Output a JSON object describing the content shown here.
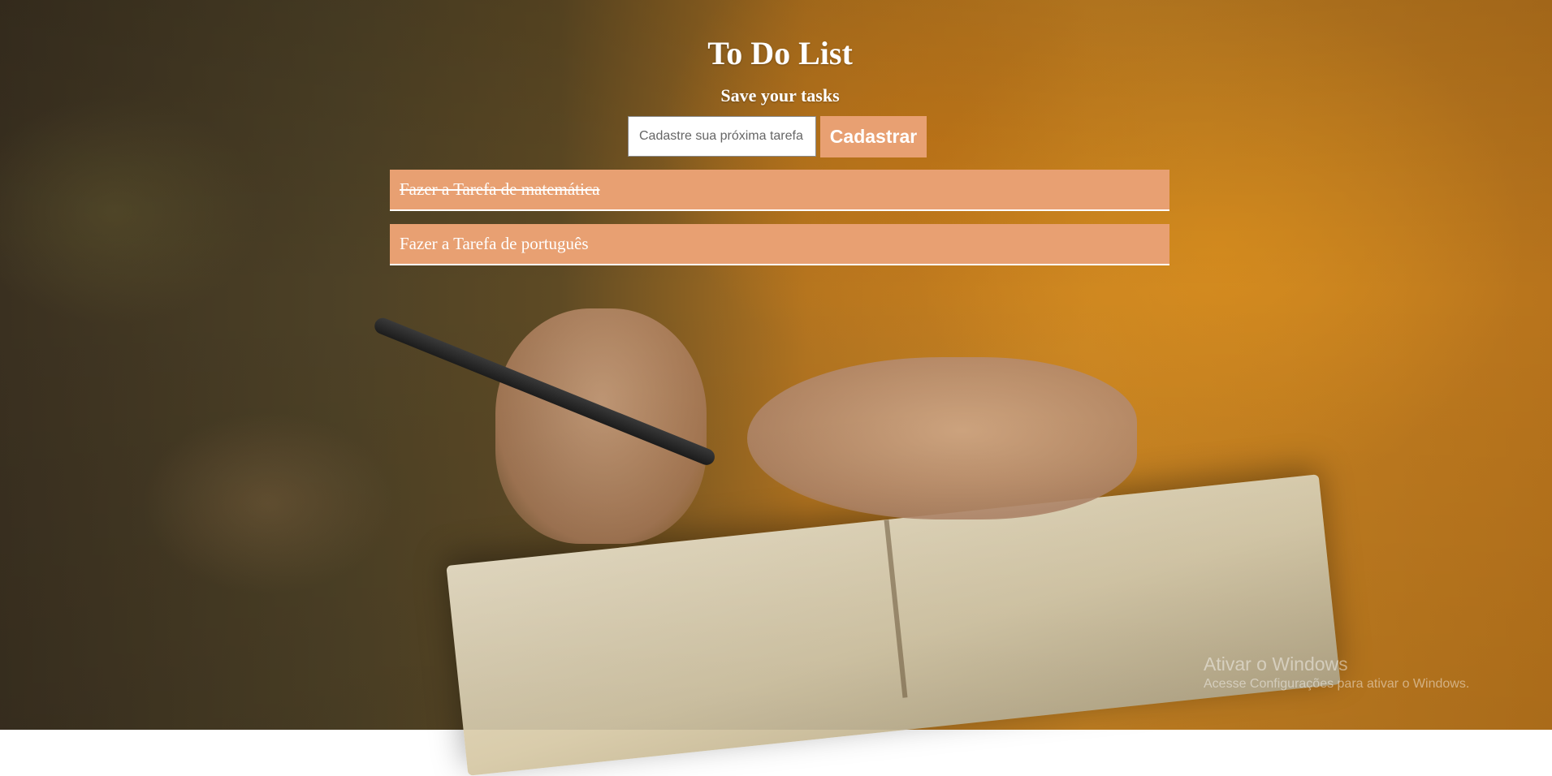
{
  "header": {
    "title": "To Do List",
    "subtitle": "Save your tasks"
  },
  "form": {
    "input_placeholder": "Cadastre sua próxima tarefa",
    "input_value": "",
    "submit_label": "Cadastrar"
  },
  "tasks": [
    {
      "text": "Fazer a Tarefa de matemática",
      "completed": true
    },
    {
      "text": "Fazer a Tarefa de português",
      "completed": false
    }
  ],
  "watermark": {
    "title": "Ativar o Windows",
    "subtitle": "Acesse Configurações para ativar o Windows."
  },
  "colors": {
    "accent": "#e8a072",
    "text": "#ffffff"
  }
}
